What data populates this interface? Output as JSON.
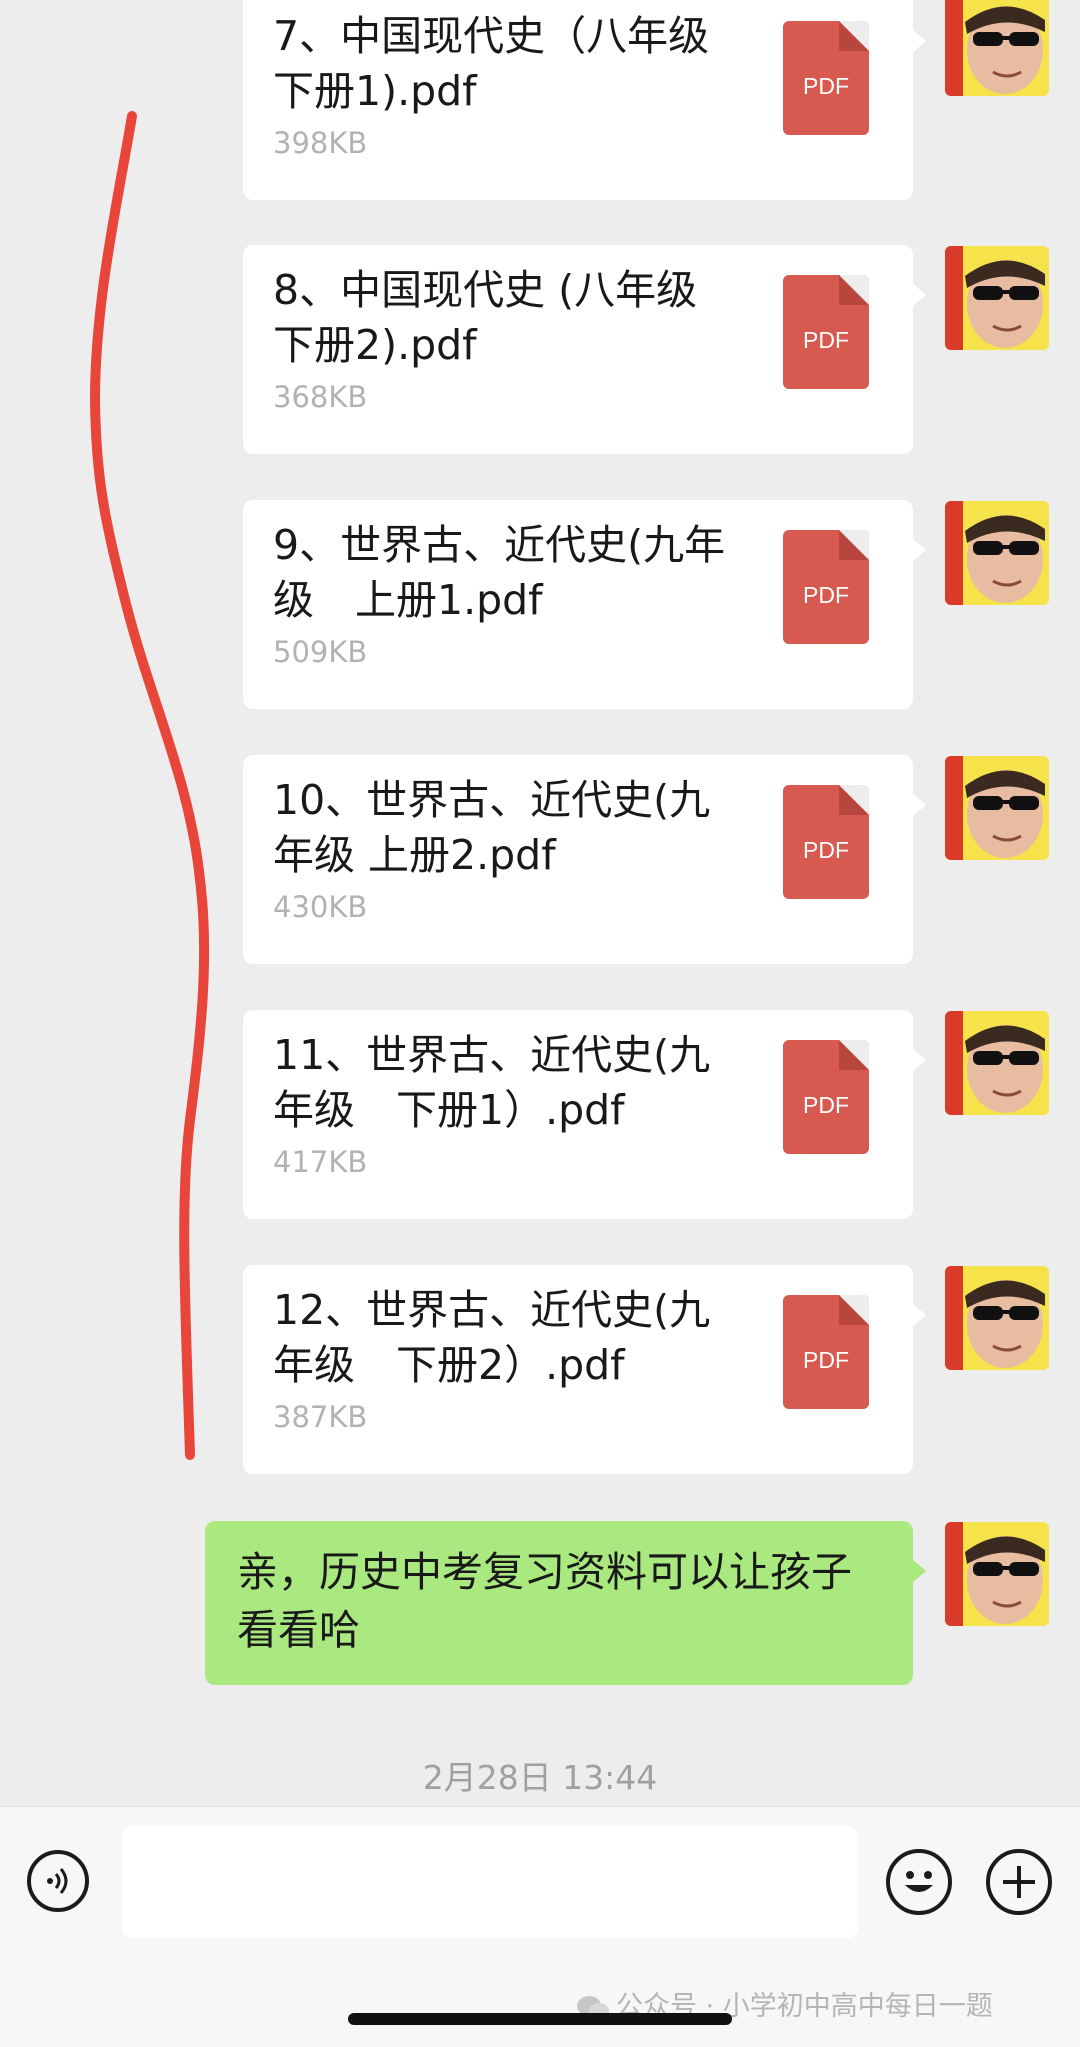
{
  "files": [
    {
      "name": "7、中国现代史（八年级　下册1).pdf",
      "size": "398KB",
      "type_label": "PDF"
    },
    {
      "name": "8、中国现代史 (八年级　　下册2).pdf",
      "size": "368KB",
      "type_label": "PDF"
    },
    {
      "name": "9、世界古、近代史(九年级　上册1.pdf",
      "size": "509KB",
      "type_label": "PDF"
    },
    {
      "name": "10、世界古、近代史(九年级 上册2.pdf",
      "size": "430KB",
      "type_label": "PDF"
    },
    {
      "name": "11、世界古、近代史(九年级　下册1）.pdf",
      "size": "417KB",
      "type_label": "PDF"
    },
    {
      "name": "12、世界古、近代史(九年级　下册2）.pdf",
      "size": "387KB",
      "type_label": "PDF"
    }
  ],
  "last_message": {
    "text": "亲，历史中考复习资料可以让孩子看看哈"
  },
  "timestamp": "2月28日 13:44",
  "input": {
    "placeholder": ""
  },
  "watermark": "公众号 · 小学初中高中每日一题",
  "colors": {
    "chat_background": "#ededed",
    "sent_bubble": "#a9e97f",
    "file_bubble": "#ffffff",
    "pdf_icon": "#d65a4f",
    "annotation_stroke": "#e8463a"
  }
}
